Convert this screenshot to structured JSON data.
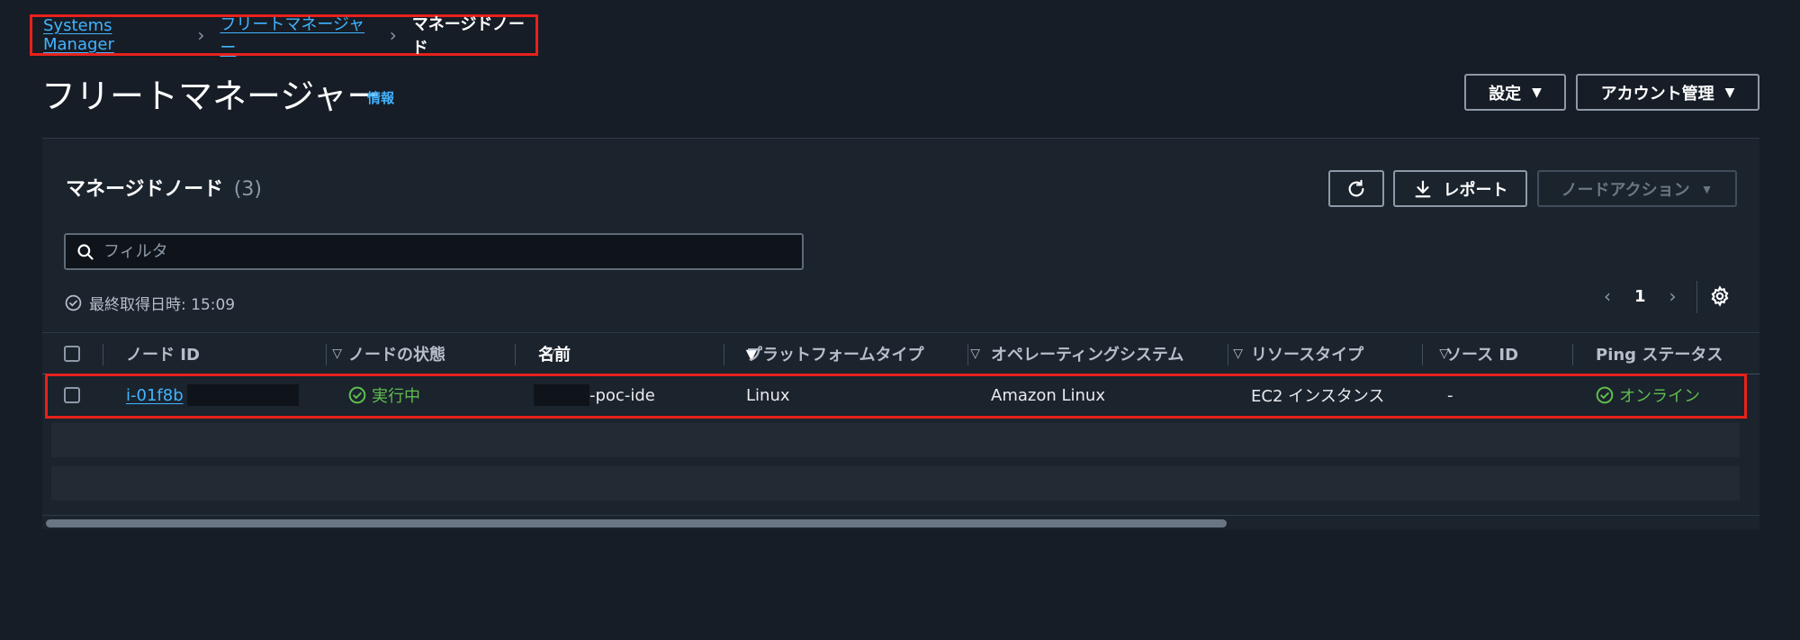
{
  "breadcrumb": {
    "items": [
      "Systems Manager",
      "フリートマネージャー"
    ],
    "current": "マネージドノード"
  },
  "header": {
    "title": "フリートマネージャー",
    "info": "情報",
    "settings_label": "設定",
    "account_label": "アカウント管理"
  },
  "panel": {
    "title": "マネージドノード",
    "count": "(3)",
    "refresh_icon": "refresh-icon",
    "report_label": "レポート",
    "node_action_label": "ノードアクション",
    "search_placeholder": "フィルタ",
    "last_updated": "最終取得日時: 15:09",
    "page": "1"
  },
  "table": {
    "columns": [
      "ノード ID",
      "ノードの状態",
      "名前",
      "プラットフォームタイプ",
      "オペレーティングシステム",
      "リソースタイプ",
      "ソース ID",
      "Ping ステータス"
    ],
    "sorted_column": "名前",
    "rows": [
      {
        "node_id": "i-01f8b",
        "state": "実行中",
        "name": "-poc-ide",
        "platform": "Linux",
        "os": "Amazon Linux",
        "resource_type": "EC2 インスタンス",
        "source_id": "-",
        "ping": "オンライン"
      }
    ]
  },
  "colors": {
    "background": "#161d26",
    "panel": "#1b232d",
    "link": "#42b4ff",
    "success": "#5fbd4e",
    "highlight": "#e8211c"
  }
}
